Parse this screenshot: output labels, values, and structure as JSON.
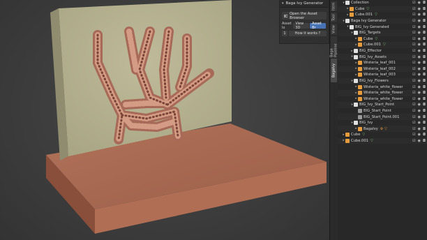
{
  "addon_panel": {
    "title": "Baga Ivy Generator",
    "open_button": "Open the Asset Browser",
    "asset_label": "Asset lo",
    "asset_options": [
      "View 3D",
      "Asset Br"
    ],
    "number": "1",
    "how_button": "How it works ?"
  },
  "side_tabs": [
    "Item",
    "Tool",
    "View",
    "Baga Pipeline",
    "BagaIvy"
  ],
  "outliner": {
    "rows": [
      {
        "indent": 1,
        "exp": "▾",
        "icon": "coll",
        "label": "Collection",
        "mini": ""
      },
      {
        "indent": 2,
        "exp": "▸",
        "icon": "obj",
        "label": "Cube",
        "mini": "▽"
      },
      {
        "indent": 2,
        "exp": "▸",
        "icon": "obj",
        "label": "Cube.001",
        "mini": "▽"
      },
      {
        "indent": 1,
        "exp": "▾",
        "icon": "coll",
        "label": "Baga Ivy Generator",
        "mini": ""
      },
      {
        "indent": 2,
        "exp": "▾",
        "icon": "coll",
        "label": "BIG_Ivy Generated",
        "mini": ""
      },
      {
        "indent": 3,
        "exp": "▾",
        "icon": "coll",
        "label": "BIG_Targets",
        "mini": ""
      },
      {
        "indent": 4,
        "exp": "▸",
        "icon": "obj",
        "label": "Cube",
        "mini": "▽"
      },
      {
        "indent": 4,
        "exp": "▸",
        "icon": "obj",
        "label": "Cube.001",
        "mini": "▽"
      },
      {
        "indent": 3,
        "exp": "▸",
        "icon": "coll",
        "label": "BIG_Effector",
        "mini": ""
      },
      {
        "indent": 3,
        "exp": "▾",
        "icon": "coll",
        "label": "BIG_Ivy_Assets",
        "mini": ""
      },
      {
        "indent": 4,
        "exp": "▸",
        "icon": "obj",
        "label": "Wisteria_leaf_001",
        "mini": ""
      },
      {
        "indent": 4,
        "exp": "▸",
        "icon": "obj",
        "label": "Wisteria_leaf_002",
        "mini": ""
      },
      {
        "indent": 4,
        "exp": "▸",
        "icon": "obj",
        "label": "Wisteria_leaf_003",
        "mini": ""
      },
      {
        "indent": 3,
        "exp": "▾",
        "icon": "coll",
        "label": "BIG_Ivy_Flowers",
        "mini": ""
      },
      {
        "indent": 4,
        "exp": "▸",
        "icon": "obj",
        "label": "Wisteria_white_flower",
        "mini": ""
      },
      {
        "indent": 4,
        "exp": "▸",
        "icon": "obj",
        "label": "Wisteria_white_flower",
        "mini": ""
      },
      {
        "indent": 4,
        "exp": "▸",
        "icon": "obj",
        "label": "Wisteria_white_flower",
        "mini": ""
      },
      {
        "indent": 3,
        "exp": "▾",
        "icon": "coll",
        "label": "BIG_Ivy_Start_Point",
        "mini": ""
      },
      {
        "indent": 4,
        "exp": "",
        "icon": "empty",
        "label": "BIG_Start_Point",
        "mini": ""
      },
      {
        "indent": 4,
        "exp": "",
        "icon": "empty",
        "label": "BIG_Start_Point.001",
        "mini": ""
      },
      {
        "indent": 3,
        "exp": "▾",
        "icon": "coll",
        "label": "BIG_Ivy",
        "mini": ""
      },
      {
        "indent": 4,
        "exp": "▸",
        "icon": "obj",
        "label": "BagaIvy",
        "mini": "⚙ ▽"
      },
      {
        "indent": 1,
        "exp": "▸",
        "icon": "obj",
        "label": "Cube",
        "mini": "▽"
      },
      {
        "indent": 1,
        "exp": "▸",
        "icon": "obj",
        "label": "Cube.001",
        "mini": "▽"
      }
    ]
  }
}
